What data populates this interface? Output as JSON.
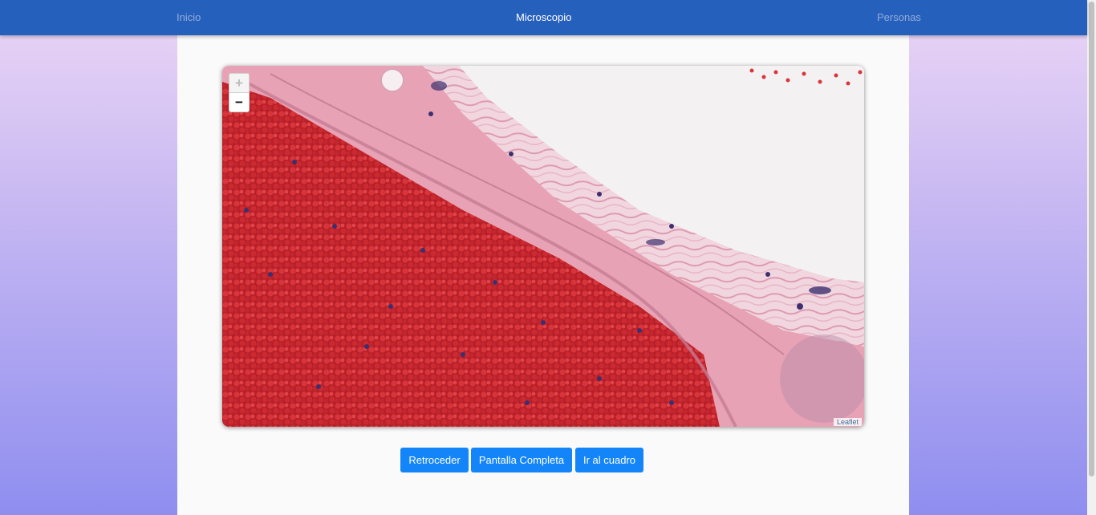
{
  "nav": {
    "inicio": "Inicio",
    "microscopio": "Microscopio",
    "personas": "Personas"
  },
  "viewer": {
    "zoom_in": "+",
    "zoom_out": "−",
    "attribution": "Leaflet"
  },
  "buttons": {
    "back": "Retroceder",
    "fullscreen": "Pantalla Completa",
    "goto": "Ir al cuadro"
  },
  "colors": {
    "navbar": "#2660bd",
    "button": "#1385f8",
    "tissue_red": "#c8262c",
    "tissue_pink": "#e9a6b8",
    "nuclei": "#3d2f6e"
  }
}
